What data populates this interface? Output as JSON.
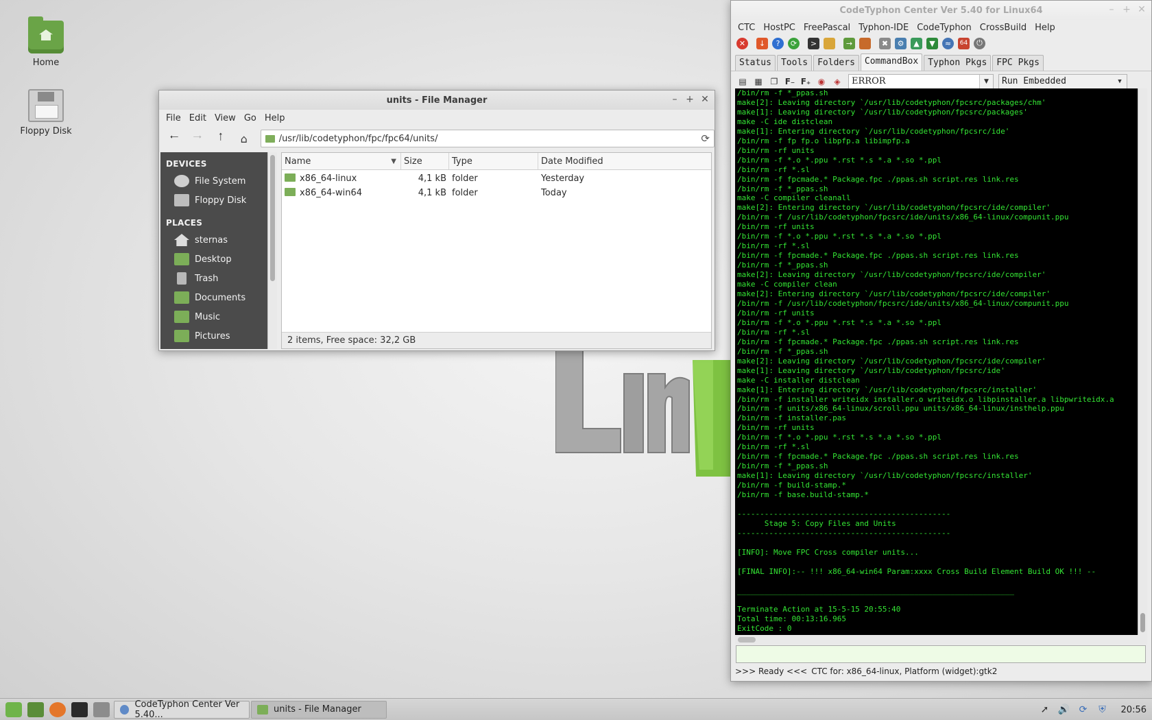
{
  "desktop": {
    "icons": [
      {
        "label": "Home"
      },
      {
        "label": "Floppy Disk"
      }
    ]
  },
  "file_manager": {
    "title": "units - File Manager",
    "menu": [
      "File",
      "Edit",
      "View",
      "Go",
      "Help"
    ],
    "path": "/usr/lib/codetyphon/fpc/fpc64/units/",
    "sidebar": {
      "devices_heading": "DEVICES",
      "devices": [
        "File System",
        "Floppy Disk"
      ],
      "places_heading": "PLACES",
      "places": [
        "sternas",
        "Desktop",
        "Trash",
        "Documents",
        "Music",
        "Pictures"
      ]
    },
    "columns": {
      "name": "Name",
      "size": "Size",
      "type": "Type",
      "date": "Date Modified"
    },
    "rows": [
      {
        "name": "x86_64-linux",
        "size": "4,1 kB",
        "type": "folder",
        "date": "Yesterday"
      },
      {
        "name": "x86_64-win64",
        "size": "4,1 kB",
        "type": "folder",
        "date": "Today"
      }
    ],
    "status": "2 items, Free space: 32,2 GB"
  },
  "codetyphon": {
    "title": "CodeTyphon Center Ver 5.40 for Linux64",
    "menu": [
      "CTC",
      "HostPC",
      "FreePascal",
      "Typhon-IDE",
      "CodeTyphon",
      "CrossBuild",
      "Help"
    ],
    "tabs": [
      "Status",
      "Tools",
      "Folders",
      "CommandBox",
      "Typhon Pkgs",
      "FPC Pkgs"
    ],
    "filter_value": "ERROR",
    "run_mode": "Run Embedded",
    "terminal_lines": [
      "/bin/rm -f *_ppas.sh",
      "make[2]: Leaving directory `/usr/lib/codetyphon/fpcsrc/packages/chm'",
      "make[1]: Leaving directory `/usr/lib/codetyphon/fpcsrc/packages'",
      "make -C ide distclean",
      "make[1]: Entering directory `/usr/lib/codetyphon/fpcsrc/ide'",
      "/bin/rm -f fp fp.o libpfp.a libimpfp.a",
      "/bin/rm -rf units",
      "/bin/rm -f *.o *.ppu *.rst *.s *.a *.so *.ppl",
      "/bin/rm -rf *.sl",
      "/bin/rm -f fpcmade.* Package.fpc ./ppas.sh script.res link.res",
      "/bin/rm -f *_ppas.sh",
      "make -C compiler cleanall",
      "make[2]: Entering directory `/usr/lib/codetyphon/fpcsrc/ide/compiler'",
      "/bin/rm -f /usr/lib/codetyphon/fpcsrc/ide/units/x86_64-linux/compunit.ppu",
      "/bin/rm -rf units",
      "/bin/rm -f *.o *.ppu *.rst *.s *.a *.so *.ppl",
      "/bin/rm -rf *.sl",
      "/bin/rm -f fpcmade.* Package.fpc ./ppas.sh script.res link.res",
      "/bin/rm -f *_ppas.sh",
      "make[2]: Leaving directory `/usr/lib/codetyphon/fpcsrc/ide/compiler'",
      "make -C compiler clean",
      "make[2]: Entering directory `/usr/lib/codetyphon/fpcsrc/ide/compiler'",
      "/bin/rm -f /usr/lib/codetyphon/fpcsrc/ide/units/x86_64-linux/compunit.ppu",
      "/bin/rm -rf units",
      "/bin/rm -f *.o *.ppu *.rst *.s *.a *.so *.ppl",
      "/bin/rm -rf *.sl",
      "/bin/rm -f fpcmade.* Package.fpc ./ppas.sh script.res link.res",
      "/bin/rm -f *_ppas.sh",
      "make[2]: Leaving directory `/usr/lib/codetyphon/fpcsrc/ide/compiler'",
      "make[1]: Leaving directory `/usr/lib/codetyphon/fpcsrc/ide'",
      "make -C installer distclean",
      "make[1]: Entering directory `/usr/lib/codetyphon/fpcsrc/installer'",
      "/bin/rm -f installer writeidx installer.o writeidx.o libpinstaller.a libpwriteidx.a",
      "/bin/rm -f units/x86_64-linux/scroll.ppu units/x86_64-linux/insthelp.ppu",
      "/bin/rm -f installer.pas",
      "/bin/rm -rf units",
      "/bin/rm -f *.o *.ppu *.rst *.s *.a *.so *.ppl",
      "/bin/rm -rf *.sl",
      "/bin/rm -f fpcmade.* Package.fpc ./ppas.sh script.res link.res",
      "/bin/rm -f *_ppas.sh",
      "make[1]: Leaving directory `/usr/lib/codetyphon/fpcsrc/installer'",
      "/bin/rm -f build-stamp.*",
      "/bin/rm -f base.build-stamp.*",
      "",
      "-----------------------------------------------",
      "      Stage 5: Copy Files and Units",
      "-----------------------------------------------",
      "",
      "[INFO]: Move FPC Cross compiler units...",
      "",
      "[FINAL INFO]:-- !!! x86_64-win64 Param:xxxx Cross Build Element Build OK !!! --",
      "",
      "_____________________________________________________________",
      "",
      "Terminate Action at 15-5-15 20:55:40",
      "Total time: 00:13:16.965",
      "ExitCode : 0"
    ],
    "status_ready": ">>> Ready <<<",
    "status_info": "CTC for: x86_64-linux, Platform (widget):gtk2"
  },
  "taskbar": {
    "tasks": [
      {
        "label": "CodeTyphon Center Ver 5.40..."
      },
      {
        "label": "units - File Manager"
      }
    ],
    "clock": "20:56"
  }
}
